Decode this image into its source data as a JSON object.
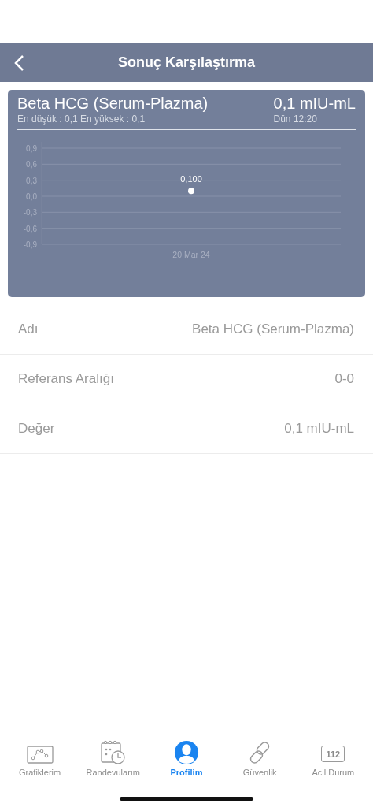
{
  "header": {
    "title": "Sonuç Karşılaştırma"
  },
  "card": {
    "name": "Beta HCG (Serum-Plazma)",
    "value": "0,1 mIU-mL",
    "range": "En düşük : 0,1 En yüksek : 0,1",
    "time": "Dün 12:20",
    "chart_data": {
      "type": "scatter",
      "categories": [
        "20 Mar 24"
      ],
      "series": [
        {
          "color": "#ffffff",
          "values": [
            0.1
          ]
        }
      ],
      "grid": true,
      "ylim": [
        -0.9,
        0.9
      ],
      "yticks": [
        {
          "value": 0.9,
          "label": "0,9"
        },
        {
          "value": 0.6,
          "label": "0,6"
        },
        {
          "value": 0.3,
          "label": "0,3"
        },
        {
          "value": 0,
          "label": "0,0"
        },
        {
          "value": -0.3,
          "label": "-0,3"
        },
        {
          "value": -0.6,
          "label": "-0,6"
        },
        {
          "value": -0.9,
          "label": "-0,9"
        }
      ],
      "value_labels": [
        "0,100"
      ]
    }
  },
  "details": [
    {
      "label": "Adı",
      "value": "Beta HCG (Serum-Plazma)"
    },
    {
      "label": "Referans Aralığı",
      "value": "0-0"
    },
    {
      "label": "Değer",
      "value": "0,1 mIU-mL"
    }
  ],
  "tabs": [
    {
      "kind": "chart",
      "label": "Grafiklerim",
      "selected": false
    },
    {
      "kind": "calendar",
      "label": "Randevularım",
      "selected": false
    },
    {
      "kind": "profile",
      "label": "Profilim",
      "selected": true
    },
    {
      "kind": "link",
      "label": "Güvenlik",
      "selected": false
    },
    {
      "kind": "emergency",
      "label": "Acil Durum",
      "icon_text": "112",
      "selected": false
    }
  ]
}
